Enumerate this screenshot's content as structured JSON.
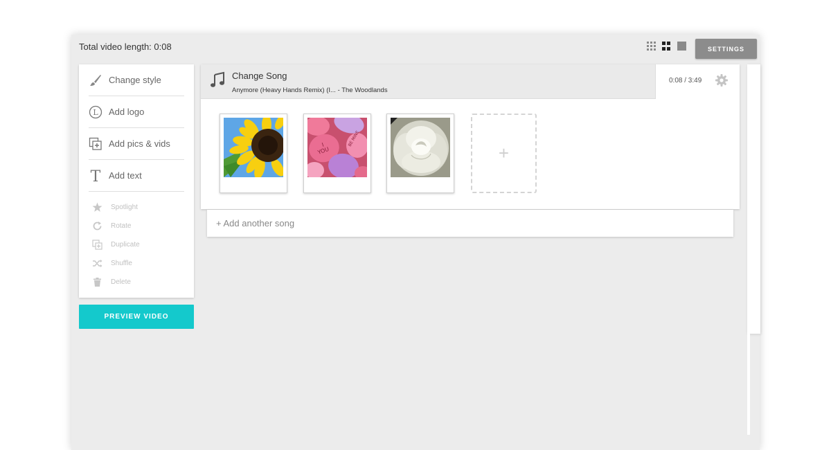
{
  "topbar": {
    "total_length": "Total video length: 0:08",
    "settings_label": "SETTINGS",
    "view_modes": [
      "small-grid-icon",
      "medium-grid-icon",
      "large-tile-icon"
    ]
  },
  "sidebar": {
    "main_items": [
      {
        "label": "Change style",
        "icon": "paintbrush-icon"
      },
      {
        "label": "Add logo",
        "icon": "logo-icon"
      },
      {
        "label": "Add pics & vids",
        "icon": "add-media-icon"
      },
      {
        "label": "Add text",
        "icon": "text-icon"
      }
    ],
    "disabled_items": [
      {
        "label": "Spotlight",
        "icon": "star-icon"
      },
      {
        "label": "Rotate",
        "icon": "rotate-icon"
      },
      {
        "label": "Duplicate",
        "icon": "duplicate-icon"
      },
      {
        "label": "Shuffle",
        "icon": "shuffle-icon"
      },
      {
        "label": "Delete",
        "icon": "trash-icon"
      }
    ]
  },
  "preview_button": "PREVIEW VIDEO",
  "song": {
    "change_label": "Change Song",
    "name": "Anymore (Heavy Hands Remix) (I... - The Woodlands",
    "time": "0:08 / 3:49"
  },
  "media": {
    "thumbnails": [
      "sunflower",
      "candy hearts",
      "white rose"
    ],
    "add_symbol": "+"
  },
  "add_song": "+ Add another song",
  "colors": {
    "accent": "#14c9cc",
    "settings_button": "#8c8c8c",
    "background": "#ececec"
  }
}
